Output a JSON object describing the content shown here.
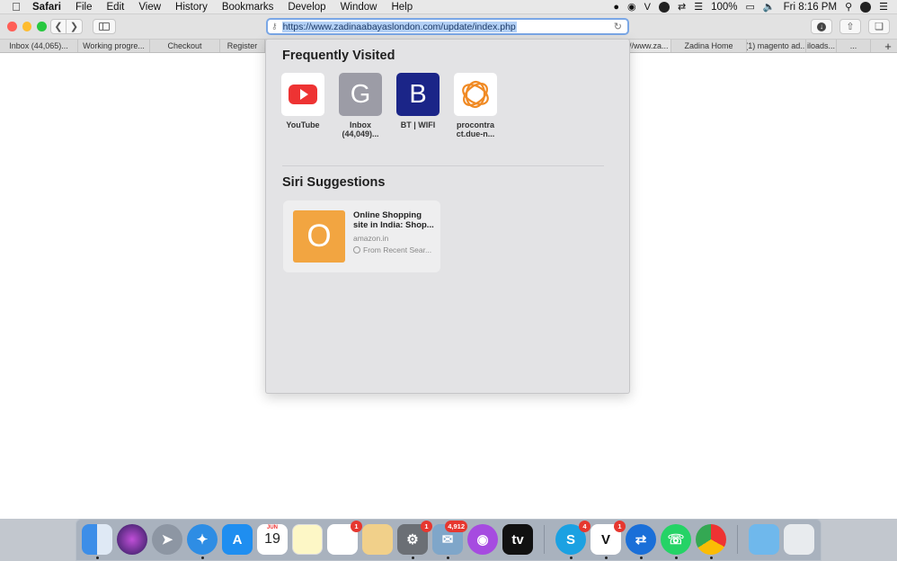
{
  "menubar": {
    "apple": "",
    "items": [
      "Safari",
      "File",
      "Edit",
      "View",
      "History",
      "Bookmarks",
      "Develop",
      "Window",
      "Help"
    ],
    "battery": "100%",
    "clock": "Fri 8:16 PM"
  },
  "toolbar": {
    "url": "https://www.zadinaabayaslondon.com/update/index.php"
  },
  "favorites": [
    "Inbox (44,065)...",
    "Working progre...",
    "Checkout",
    "Register",
    "",
    "",
    "",
    "",
    "://www.za...",
    "Zadina Home",
    "(1) magento ad...",
    "iloads...",
    "..."
  ],
  "dropdown": {
    "frequently_visited_title": "Frequently Visited",
    "sites": [
      {
        "label": "YouTube",
        "letter": ""
      },
      {
        "label": "Inbox (44,049)...",
        "letter": "G"
      },
      {
        "label": "BT | WIFI",
        "letter": "B"
      },
      {
        "label": "procontra ct.due-n...",
        "letter": ""
      }
    ],
    "siri_title": "Siri Suggestions",
    "suggestion": {
      "letter": "O",
      "title": "Online Shopping site in India: Shop...",
      "domain": "amazon.in",
      "source": "From Recent Sear..."
    }
  },
  "dock": {
    "calendar_month": "JUN",
    "calendar_day": "19",
    "badges": {
      "reminders": "1",
      "system_prefs": "1",
      "mail": "4,912",
      "skype": "4",
      "vectorworks": "1"
    },
    "appletv_label": "tv"
  },
  "colors": {
    "accent": "#7aa7e6",
    "youtube": "#ee3333",
    "bt": "#1b2588",
    "amazon": "#f2a541"
  }
}
